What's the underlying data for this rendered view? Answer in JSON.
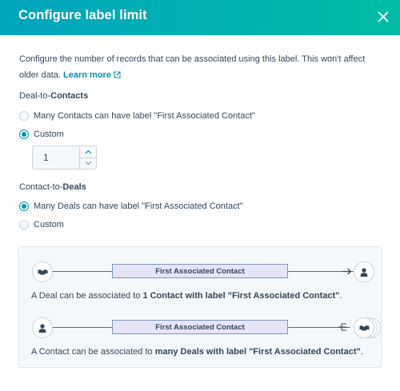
{
  "modal": {
    "title": "Configure label limit",
    "close_icon": "close-icon"
  },
  "intro": {
    "text": "Configure the number of records that can be associated using this label. This won't affect older data.",
    "learn_more": "Learn more"
  },
  "deal_to_contacts": {
    "title_prefix": "Deal-to-",
    "title_object": "Contacts",
    "options": [
      {
        "label": "Many Contacts can have label \"First Associated Contact\"",
        "checked": false
      },
      {
        "label": "Custom",
        "checked": true
      }
    ],
    "custom_value": "1"
  },
  "contact_to_deals": {
    "title_prefix": "Contact-to-",
    "title_object": "Deals",
    "options": [
      {
        "label": "Many Deals can have label \"First Associated Contact\"",
        "checked": true
      },
      {
        "label": "Custom",
        "checked": false
      }
    ]
  },
  "diagram": {
    "row1": {
      "label": "First Associated Contact",
      "desc_prefix": "A Deal can be associated to ",
      "desc_bold": "1 Contact with label \"First Associated Contact\"",
      "desc_suffix": "."
    },
    "row2": {
      "label": "First Associated Contact",
      "desc_prefix": "A Contact can be associated to ",
      "desc_bold": "many Deals with label \"First Associated Contact\"",
      "desc_suffix": "."
    }
  },
  "colors": {
    "header_start": "#00a4bd",
    "header_end": "#00bda5",
    "link": "#0091ae",
    "text": "#33475b"
  }
}
